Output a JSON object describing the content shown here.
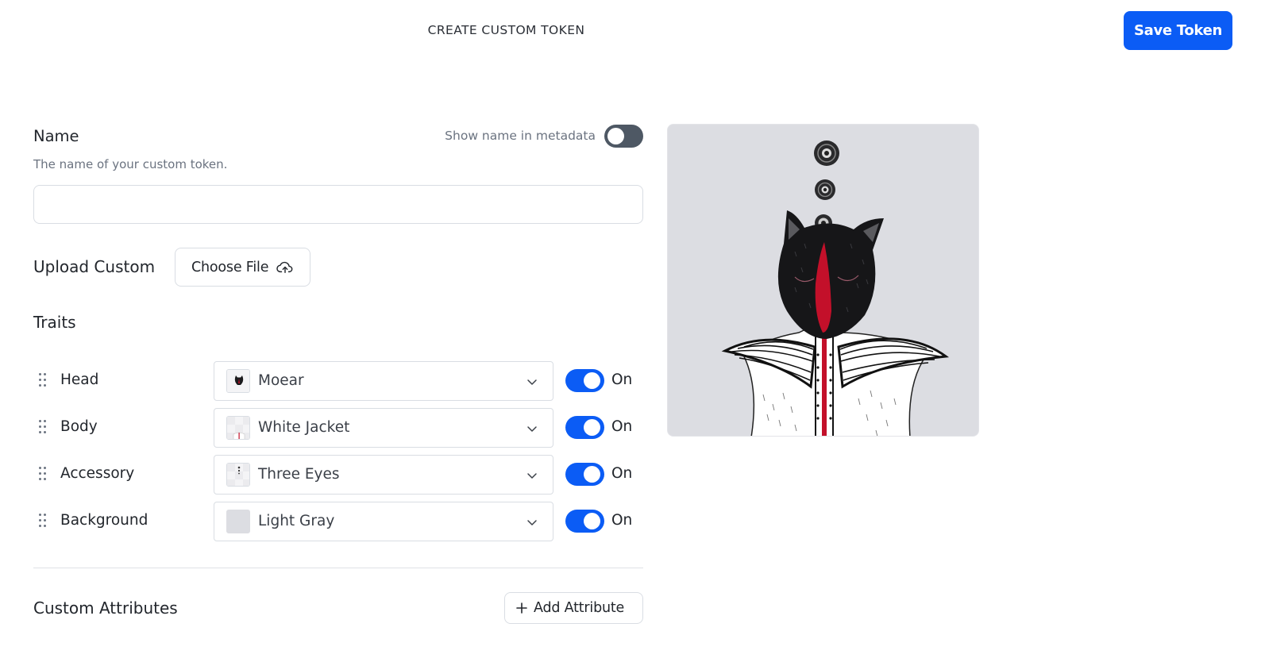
{
  "header": {
    "title": "CREATE CUSTOM TOKEN",
    "save_label": "Save Token"
  },
  "name_section": {
    "label": "Name",
    "help": "The name of your custom token.",
    "show_in_metadata_label": "Show name in metadata",
    "show_in_metadata": false,
    "value": "",
    "placeholder": ""
  },
  "upload": {
    "label": "Upload Custom",
    "button_label": "Choose File"
  },
  "traits": {
    "label": "Traits",
    "items": [
      {
        "name": "Head",
        "value": "Moear",
        "enabled": true,
        "toggle_label": "On",
        "thumb": "cat-head-thumbnail"
      },
      {
        "name": "Body",
        "value": "White Jacket",
        "enabled": true,
        "toggle_label": "On",
        "thumb": "jacket-thumbnail"
      },
      {
        "name": "Accessory",
        "value": "Three Eyes",
        "enabled": true,
        "toggle_label": "On",
        "thumb": "eyes-thumbnail"
      },
      {
        "name": "Background",
        "value": "Light Gray",
        "enabled": true,
        "toggle_label": "On",
        "thumb": "gray-swatch",
        "swatch_color": "#dcdde2"
      }
    ]
  },
  "custom_attributes": {
    "label": "Custom Attributes",
    "add_label": "Add Attribute"
  },
  "colors": {
    "accent": "#0b5cf5",
    "toggle_off": "#4e5864",
    "preview_bg": "#dcdde2",
    "accent_red": "#c3102a"
  }
}
